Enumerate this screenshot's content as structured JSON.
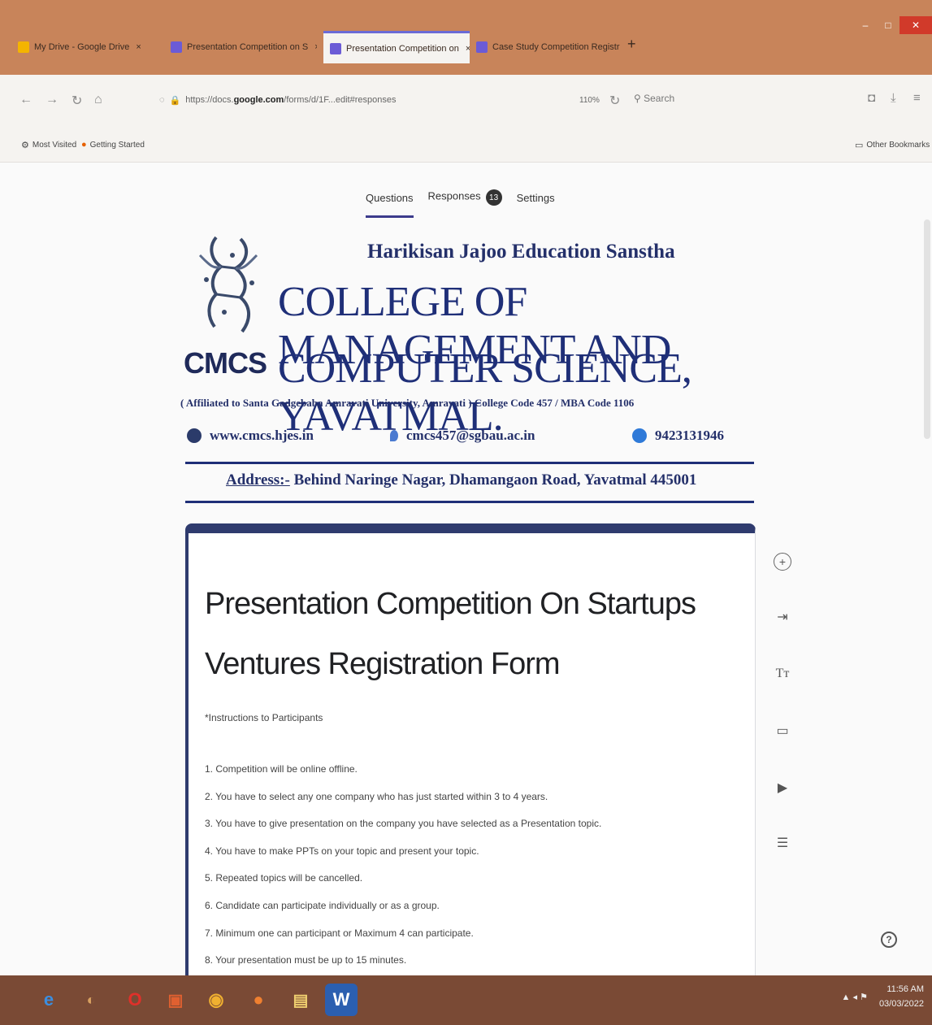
{
  "browser": {
    "tabs": [
      {
        "label": "My Drive - Google Drive",
        "active": false,
        "favicon_color": "#f4b400"
      },
      {
        "label": "Presentation Competition on S",
        "active": false,
        "favicon_color": "#6b5bd6"
      },
      {
        "label": "Presentation Competition on",
        "active": true,
        "favicon_color": "#6b5bd6"
      },
      {
        "label": "Case Study Competition Registr",
        "active": false,
        "favicon_color": "#6b5bd6"
      }
    ],
    "url_prefix": "https://docs.",
    "url_host": "google.com",
    "url_path": "/forms/d/1F...edit#responses",
    "zoom": "110%",
    "search_placeholder": "Search",
    "bookmarks": [
      {
        "label": "Most Visited",
        "icon": "gear-icon"
      },
      {
        "label": "Getting Started",
        "icon": "firefox-icon"
      }
    ],
    "other_bookmarks": "Other Bookmarks"
  },
  "form_tabs": {
    "questions": "Questions",
    "responses": "Responses",
    "responses_count": "13",
    "settings": "Settings"
  },
  "banner": {
    "logo_text": "CMCS",
    "org_name": "Harikisan Jajoo Education Sanstha",
    "college_line1": "COLLEGE OF MANAGEMENT AND",
    "college_line2": "COMPUTER SCIENCE, YAVATMAL.",
    "affiliation": "( Affiliated to Santa Gadgebaba Amravati University, Amravati ) College Code 457 / MBA Code 1106",
    "website": "www.cmcs.hjes.in",
    "email": "cmcs457@sgbau.ac.in",
    "phone": "9423131946",
    "address_label": "Address:-",
    "address_value": "Behind Naringe Nagar, Dhamangaon Road, Yavatmal 445001"
  },
  "form": {
    "title": "Presentation Competition On Startups Ventures Registration Form",
    "instructions_heading": "*Instructions to Participants",
    "instructions": [
      "1. Competition will be online offline.",
      "2. You have to select any one company who has just started within 3 to 4 years.",
      "3. You have to give presentation on the company you have selected as a Presentation topic.",
      "4. You have to make PPTs on your topic and present your topic.",
      "5. Repeated topics will be cancelled.",
      "6. Candidate can participate individually or as a group.",
      "7. Minimum one can participant or Maximum 4 can participate.",
      "8. Your presentation must be up to 15 minutes."
    ]
  },
  "toolbar": {
    "icons": [
      "add-question-icon",
      "import-questions-icon",
      "add-title-icon",
      "add-image-icon",
      "add-video-icon",
      "add-section-icon"
    ],
    "title_glyph": "Tт"
  },
  "taskbar": {
    "apps": [
      "ie-icon",
      "media-icon",
      "opera-icon",
      "office-icon",
      "chrome-icon",
      "firefox-icon",
      "explorer-icon",
      "word-icon"
    ],
    "time": "11:56 AM",
    "date": "03/03/2022"
  },
  "colors": {
    "titlebar": "#c8845a",
    "form_accent": "#2f3b6e",
    "banner_text": "#1f2f78",
    "taskbar": "#7a4a35"
  }
}
